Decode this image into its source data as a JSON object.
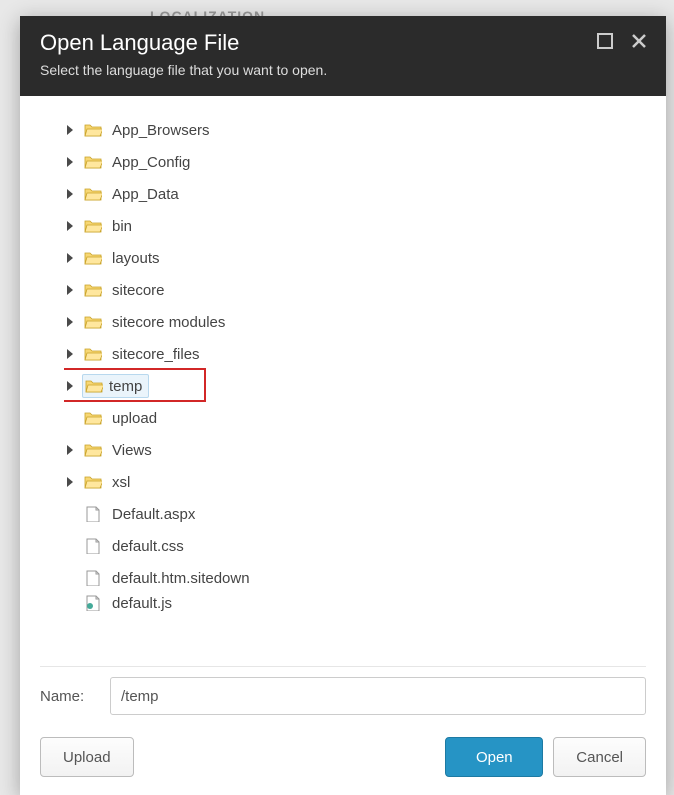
{
  "background_label": "LOCALIZATION",
  "dialog": {
    "title": "Open Language File",
    "subtitle": "Select the language file that you want to open."
  },
  "tree": {
    "items": [
      {
        "label": "App_Browsers",
        "type": "folder",
        "expandable": true
      },
      {
        "label": "App_Config",
        "type": "folder",
        "expandable": true
      },
      {
        "label": "App_Data",
        "type": "folder",
        "expandable": true
      },
      {
        "label": "bin",
        "type": "folder",
        "expandable": true
      },
      {
        "label": "layouts",
        "type": "folder",
        "expandable": true
      },
      {
        "label": "sitecore",
        "type": "folder",
        "expandable": true
      },
      {
        "label": "sitecore modules",
        "type": "folder",
        "expandable": true
      },
      {
        "label": "sitecore_files",
        "type": "folder",
        "expandable": true
      },
      {
        "label": "temp",
        "type": "folder",
        "expandable": true,
        "selected": true,
        "highlighted": true
      },
      {
        "label": "upload",
        "type": "folder",
        "expandable": false
      },
      {
        "label": "Views",
        "type": "folder",
        "expandable": true
      },
      {
        "label": "xsl",
        "type": "folder",
        "expandable": true
      },
      {
        "label": "Default.aspx",
        "type": "file",
        "expandable": false
      },
      {
        "label": "default.css",
        "type": "file",
        "expandable": false
      },
      {
        "label": "default.htm.sitedown",
        "type": "file",
        "expandable": false
      },
      {
        "label": "default.js",
        "type": "file-js",
        "expandable": false,
        "partial": true
      }
    ]
  },
  "name_field": {
    "label": "Name:",
    "value": "/temp"
  },
  "buttons": {
    "upload": "Upload",
    "open": "Open",
    "cancel": "Cancel"
  }
}
